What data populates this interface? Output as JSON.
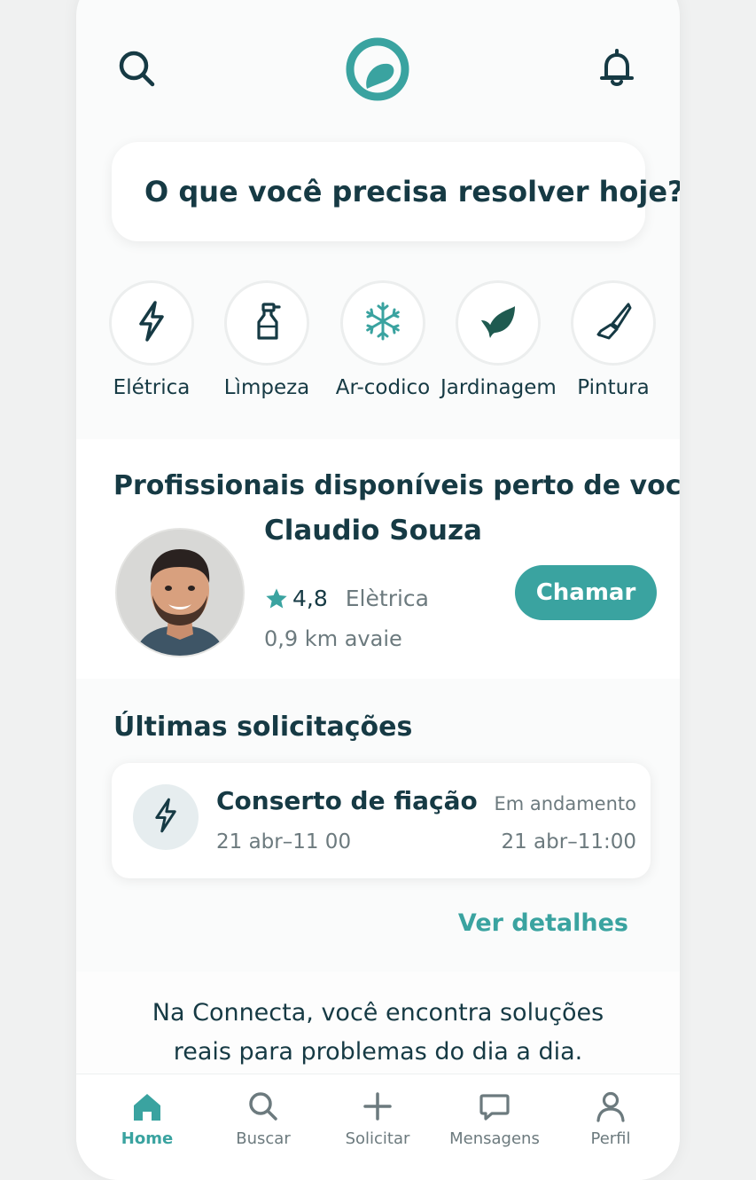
{
  "header": {
    "search_icon": "search-icon",
    "logo_icon": "app-logo",
    "bell_icon": "bell-icon"
  },
  "search": {
    "prompt": "O que você precisa resolver hoje?"
  },
  "categories": [
    {
      "label": "Elétrica",
      "icon": "lightning-icon"
    },
    {
      "label": "Lìmpeza",
      "icon": "spray-bottle-icon"
    },
    {
      "label": "Ar-codico",
      "icon": "snowflake-icon"
    },
    {
      "label": "Jardinagem",
      "icon": "leaf-icon"
    },
    {
      "label": "Pintura",
      "icon": "paintbrush-icon"
    }
  ],
  "professionals": {
    "title": "Profissionais disponíveis perto de você",
    "item": {
      "name": "Claudio Souza",
      "rating": "4,8",
      "category": "Elètrica",
      "distance": "0,9 km avaie",
      "call_label": "Chamar"
    }
  },
  "requests": {
    "title": "Últimas solicitações",
    "item": {
      "title": "Conserto de fiação",
      "date": "21 abr–11 00",
      "status": "Em andamento",
      "time": "21 abr–11:00"
    },
    "details_label": "Ver detalhes"
  },
  "tagline": {
    "line1": "Na Connecta, você encontra soluções",
    "line2": "reais para problemas do dia a dia."
  },
  "nav": [
    {
      "label": "Home",
      "icon": "home-icon",
      "active": true
    },
    {
      "label": "Buscar",
      "icon": "search-icon",
      "active": false
    },
    {
      "label": "Solicitar",
      "icon": "plus-icon",
      "active": false
    },
    {
      "label": "Mensagens",
      "icon": "chat-icon",
      "active": false
    },
    {
      "label": "Perfil",
      "icon": "user-icon",
      "active": false
    }
  ],
  "colors": {
    "accent": "#3aa3a0",
    "text_dark": "#163a44",
    "text_muted": "#6c7a7e",
    "background": "#fafbfb"
  }
}
